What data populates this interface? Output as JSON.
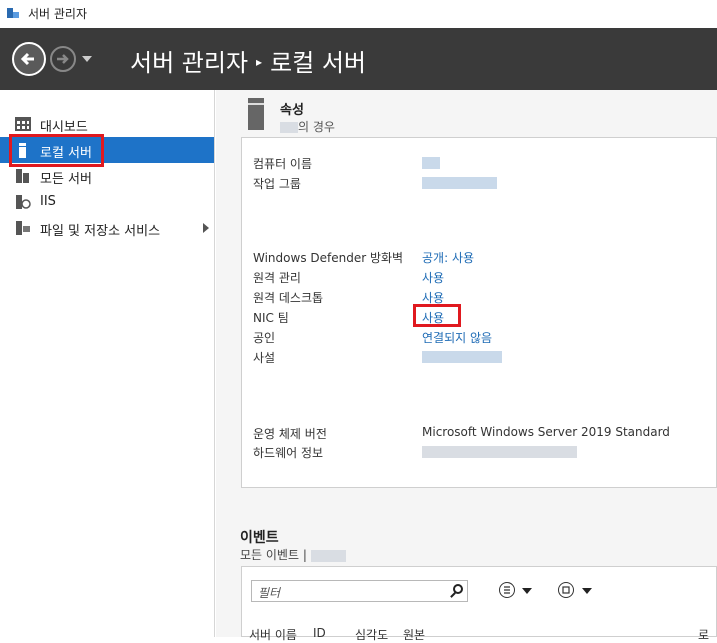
{
  "window": {
    "title": "서버 관리자"
  },
  "header": {
    "breadcrumb_root": "서버 관리자",
    "breadcrumb_separator": "▸",
    "breadcrumb_current": "로컬 서버"
  },
  "sidebar": {
    "items": [
      {
        "label": "대시보드",
        "icon": "dashboard-icon"
      },
      {
        "label": "로컬 서버",
        "icon": "server-icon"
      },
      {
        "label": "모든 서버",
        "icon": "servers-icon"
      },
      {
        "label": "IIS",
        "icon": "iis-icon"
      },
      {
        "label": "파일 및 저장소 서비스",
        "icon": "storage-icon"
      }
    ]
  },
  "properties": {
    "title": "속성",
    "subtitle_suffix": "의 경우",
    "rows": [
      {
        "label": "컴퓨터 이름"
      },
      {
        "label": "작업 그룹"
      },
      {
        "label": "Windows Defender 방화벽",
        "value": "공개: 사용"
      },
      {
        "label": "원격 관리",
        "value": "사용"
      },
      {
        "label": "원격 데스크톱",
        "value": "사용"
      },
      {
        "label": "NIC 팀",
        "value": "사용"
      },
      {
        "label": "공인",
        "value": "연결되지 않음"
      },
      {
        "label": "사설"
      },
      {
        "label": "운영 체제 버전",
        "value": "Microsoft Windows Server 2019 Standard"
      },
      {
        "label": "하드웨어 정보"
      }
    ]
  },
  "events": {
    "title": "이벤트",
    "subtitle": "모든 이벤트 |",
    "filter_placeholder": "필터",
    "columns": [
      "서버 이름",
      "ID",
      "심각도",
      "원본",
      "로"
    ]
  },
  "colors": {
    "accent": "#1e73c8",
    "link": "#1e6bb5",
    "highlight": "#e0191f",
    "header_bg": "#3a3a3a"
  }
}
